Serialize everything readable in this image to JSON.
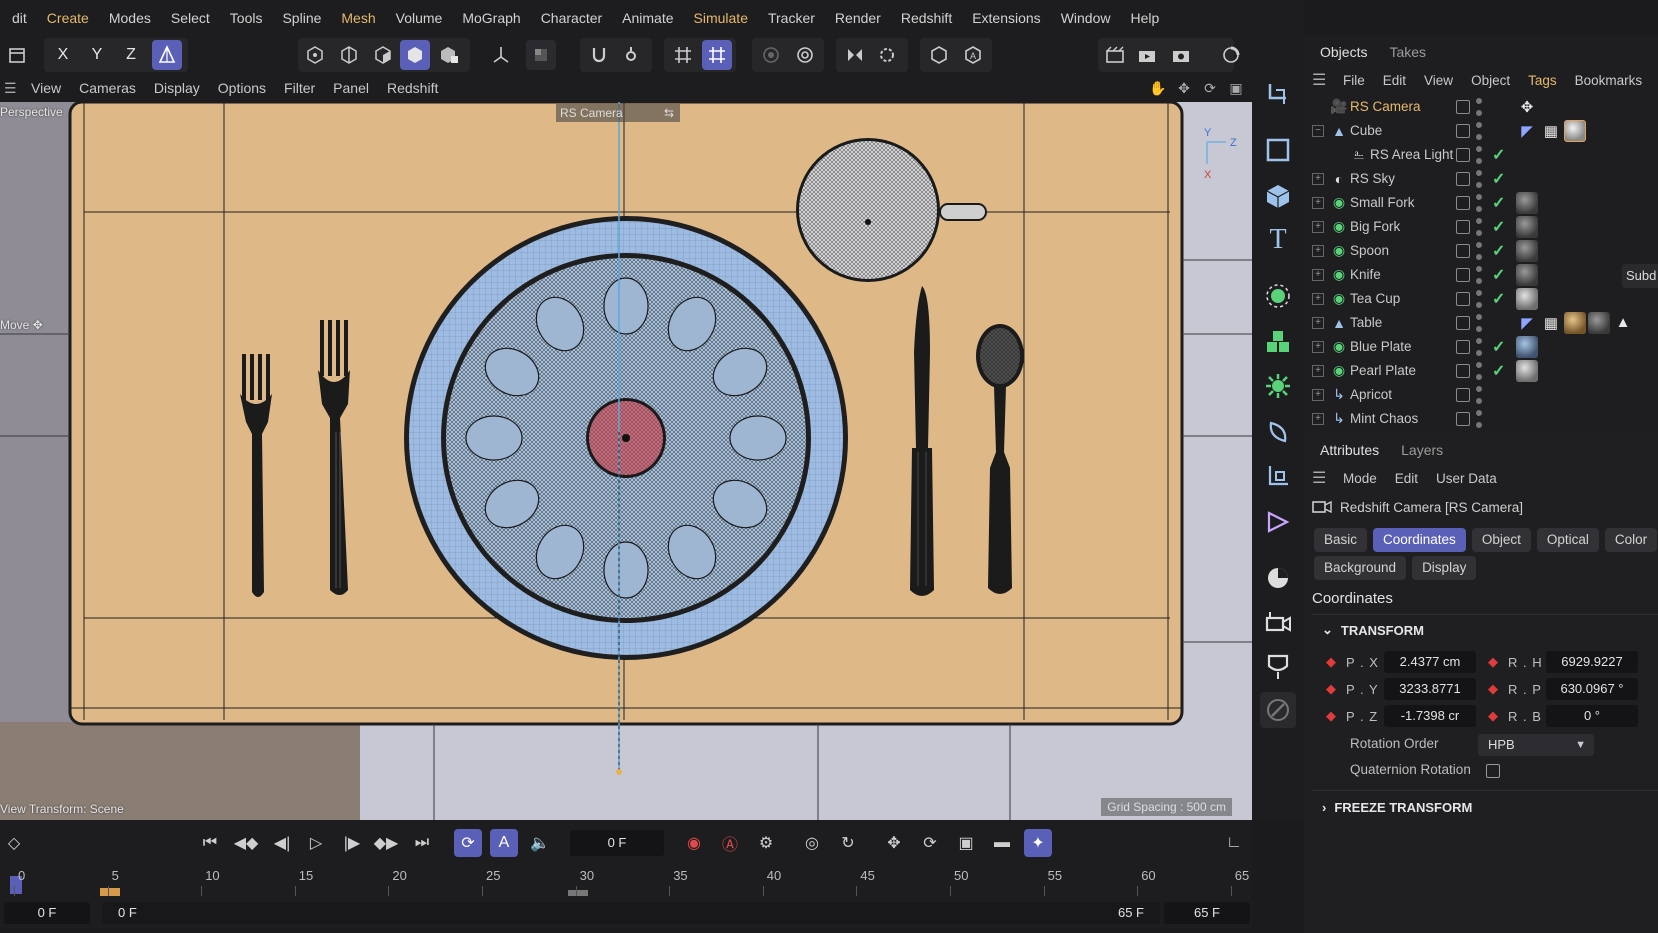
{
  "menubar": {
    "items": [
      {
        "label": "dit",
        "hl": false
      },
      {
        "label": "Create",
        "hl": true
      },
      {
        "label": "Modes",
        "hl": false
      },
      {
        "label": "Select",
        "hl": false
      },
      {
        "label": "Tools",
        "hl": false
      },
      {
        "label": "Spline",
        "hl": false
      },
      {
        "label": "Mesh",
        "hl": true
      },
      {
        "label": "Volume",
        "hl": false
      },
      {
        "label": "MoGraph",
        "hl": false
      },
      {
        "label": "Character",
        "hl": false
      },
      {
        "label": "Animate",
        "hl": false
      },
      {
        "label": "Simulate",
        "hl": true
      },
      {
        "label": "Tracker",
        "hl": false
      },
      {
        "label": "Render",
        "hl": false
      },
      {
        "label": "Redshift",
        "hl": false
      },
      {
        "label": "Extensions",
        "hl": false
      },
      {
        "label": "Window",
        "hl": false
      },
      {
        "label": "Help",
        "hl": false
      }
    ]
  },
  "toolbar": {
    "axis_x": "X",
    "axis_y": "Y",
    "axis_z": "Z"
  },
  "viewport_menu": {
    "items": [
      "View",
      "Cameras",
      "Display",
      "Options",
      "Filter",
      "Panel",
      "Redshift"
    ]
  },
  "viewport": {
    "view_name": "Perspective",
    "camera_label": "RS Camera",
    "move_label": "Move",
    "view_transform": "View Transform: Scene",
    "grid_spacing": "Grid Spacing : 500 cm",
    "axis_y": "Y",
    "axis_z": "Z",
    "axis_x": "X"
  },
  "objects_panel": {
    "tabs": [
      "Objects",
      "Takes"
    ],
    "menu": [
      {
        "label": "File",
        "hl": false
      },
      {
        "label": "Edit",
        "hl": false
      },
      {
        "label": "View",
        "hl": false
      },
      {
        "label": "Object",
        "hl": false
      },
      {
        "label": "Tags",
        "hl": true
      },
      {
        "label": "Bookmarks",
        "hl": false
      }
    ],
    "rows": [
      {
        "name": "RS Camera",
        "selected": true,
        "icon": "camera-icon",
        "checked": false,
        "tags": [
          "target-tag"
        ]
      },
      {
        "name": "Cube",
        "selected": false,
        "icon": "null-icon",
        "checked": false,
        "tags": [
          "compositing-tag",
          "checker-tag",
          "material-white"
        ]
      },
      {
        "name": "RS Area Light",
        "selected": false,
        "icon": "light-icon",
        "checked": true,
        "tags": []
      },
      {
        "name": "RS Sky",
        "selected": false,
        "icon": "sky-icon",
        "checked": true,
        "tags": []
      },
      {
        "name": "Small Fork",
        "selected": false,
        "icon": "subdivision-icon",
        "checked": true,
        "tags": [
          "material"
        ]
      },
      {
        "name": "Big Fork",
        "selected": false,
        "icon": "subdivision-icon",
        "checked": true,
        "tags": [
          "material"
        ]
      },
      {
        "name": "Spoon",
        "selected": false,
        "icon": "subdivision-icon",
        "checked": true,
        "tags": [
          "material"
        ]
      },
      {
        "name": "Knife",
        "selected": false,
        "icon": "subdivision-icon",
        "checked": true,
        "tags": [
          "material"
        ]
      },
      {
        "name": "Tea Cup",
        "selected": false,
        "icon": "subdivision-icon",
        "checked": true,
        "tags": [
          "material-pearl"
        ]
      },
      {
        "name": "Table",
        "selected": false,
        "icon": "null-icon",
        "checked": false,
        "tags": [
          "compositing-tag",
          "checker-tag",
          "material-gold",
          "material",
          "phong-tag"
        ]
      },
      {
        "name": "Blue Plate",
        "selected": false,
        "icon": "subdivision-icon",
        "checked": true,
        "tags": [
          "material-blue"
        ]
      },
      {
        "name": "Pearl Plate",
        "selected": false,
        "icon": "subdivision-icon",
        "checked": true,
        "tags": [
          "material-pearl"
        ]
      },
      {
        "name": "Apricot",
        "selected": false,
        "icon": "cloner-icon",
        "checked": false,
        "tags": []
      },
      {
        "name": "Mint Chaos",
        "selected": false,
        "icon": "cloner-icon",
        "checked": false,
        "tags": []
      }
    ],
    "tooltip": "Subd"
  },
  "attributes_panel": {
    "tabs": [
      "Attributes",
      "Layers"
    ],
    "menu": [
      "Mode",
      "Edit",
      "User Data"
    ],
    "title": "Redshift Camera [RS Camera]",
    "tabs_row1": [
      "Basic",
      "Coordinates",
      "Object",
      "Optical",
      "Color"
    ],
    "tabs_row2": [
      "Background",
      "Display"
    ],
    "selected_tab": "Coordinates",
    "section": "Coordinates",
    "transform_group": "TRANSFORM",
    "coords_left": [
      {
        "label": "P . X",
        "value": "2.4377 cm"
      },
      {
        "label": "P . Y",
        "value": "3233.8771"
      },
      {
        "label": "P . Z",
        "value": "-1.7398 cr"
      }
    ],
    "coords_right": [
      {
        "label": "R . H",
        "value": "6929.9227"
      },
      {
        "label": "R . P",
        "value": "630.0967 °"
      },
      {
        "label": "R . B",
        "value": "0 °"
      }
    ],
    "rotation_order_label": "Rotation Order",
    "rotation_order_value": "HPB",
    "quaternion_label": "Quaternion Rotation",
    "quaternion_checked": false,
    "freeze_group": "FREEZE TRANSFORM"
  },
  "timeline": {
    "current_frame": "0 F",
    "ruler_labels": [
      "0",
      "5",
      "10",
      "15",
      "20",
      "25",
      "30",
      "35",
      "40",
      "45",
      "50",
      "55",
      "60",
      "65"
    ],
    "range_start": "0 F",
    "range_start2": "0 F",
    "range_end": "65 F",
    "range_end2": "65 F"
  },
  "colors": {
    "accent": "#5a5fb8",
    "highlight": "#e5b96a",
    "keyframe": "#e23b3b",
    "check": "#59d27a",
    "table_surface": "#deb887",
    "plate_blue": "#9dbbe3",
    "plate_center": "#c96b7c"
  }
}
